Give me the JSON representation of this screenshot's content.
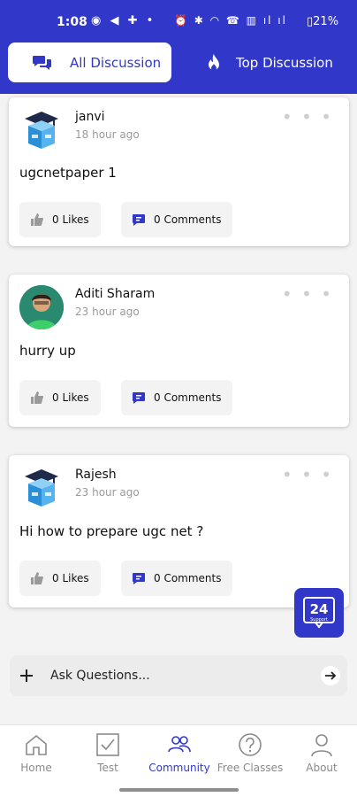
{
  "status_bar": {
    "time": "1:08",
    "left_icons": "◉ ◀ ✚ •",
    "right_icons": "⏰ ✱ ◠ ☎ ▥ ıl ıl",
    "battery": "▯21%"
  },
  "tabs": [
    {
      "label": "All Discussion",
      "icon": "chat-bubbles-icon",
      "active": true
    },
    {
      "label": "Top Discussion",
      "icon": "flame-icon",
      "active": false
    }
  ],
  "posts": [
    {
      "author": "janvi",
      "time": "18 hour ago",
      "text": "ugcnetpaper 1",
      "likes": "0 Likes",
      "comments": "0 Comments",
      "avatar": "graduation-box-logo"
    },
    {
      "author": "Aditi Sharam",
      "time": "23 hour ago",
      "text": "hurry up",
      "likes": "0 Likes",
      "comments": "0 Comments",
      "avatar": "user-photo"
    },
    {
      "author": "Rajesh",
      "time": "23 hour ago",
      "text": "Hi how to prepare ugc net ?",
      "likes": "0 Likes",
      "comments": "0 Comments",
      "avatar": "graduation-box-logo"
    }
  ],
  "post_menu": "• • •",
  "support_badge": {
    "label": "24",
    "sub": "Support"
  },
  "ask": {
    "placeholder": "Ask Questions..."
  },
  "bottom_nav": [
    {
      "label": "Home",
      "icon": "home-icon",
      "active": false
    },
    {
      "label": "Test",
      "icon": "test-checkbox-icon",
      "active": false
    },
    {
      "label": "Community",
      "icon": "community-icon",
      "active": true
    },
    {
      "label": "Free Classes",
      "icon": "help-circle-icon",
      "active": false
    },
    {
      "label": "About",
      "icon": "person-icon",
      "active": false
    }
  ],
  "colors": {
    "brand": "#3138c9",
    "background": "#f3f3f3",
    "muted_text": "#9a9a9a"
  }
}
